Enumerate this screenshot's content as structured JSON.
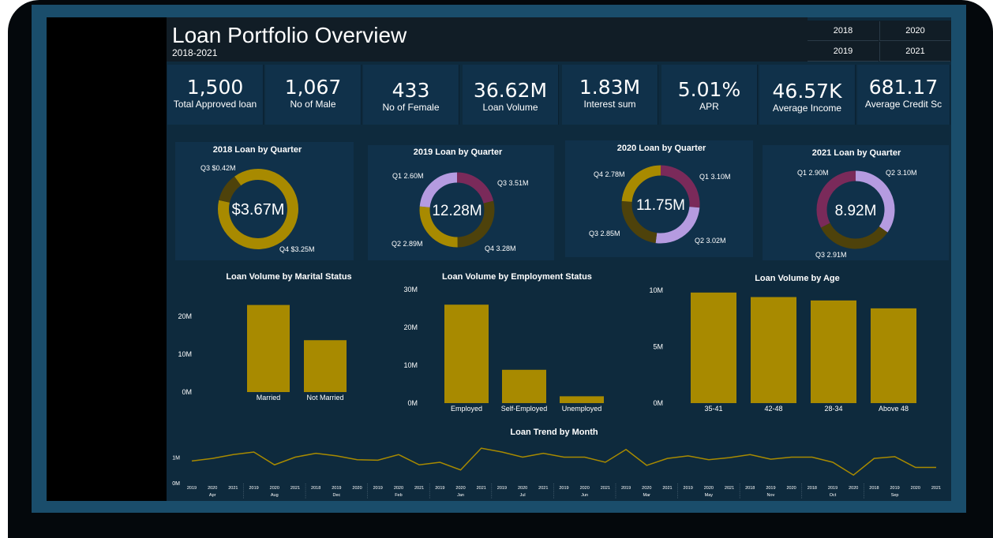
{
  "header": {
    "title": "Loan Portfolio Overview",
    "subtitle": "2018-2021"
  },
  "slicer": {
    "items": [
      "2018",
      "2020",
      "2019",
      "2021"
    ]
  },
  "kpis": [
    {
      "value": "1,500",
      "label": "Total Approved loan"
    },
    {
      "value": "1,067",
      "label": "No of Male"
    },
    {
      "value": "433",
      "label": "No of Female"
    },
    {
      "value": "36.62M",
      "label": "Loan Volume"
    },
    {
      "value": "1.83M",
      "label": "Interest sum"
    },
    {
      "value": "5.01%",
      "label": "APR"
    },
    {
      "value": "46.57K",
      "label": "Average Income"
    },
    {
      "value": "681.17",
      "label": "Average Credit Sc"
    }
  ],
  "colors": {
    "gold": "#a88a00",
    "dark_olive": "#4e420b",
    "purple": "#7a2a5a",
    "lavender": "#b59be0",
    "canvas": "#0e2a3d",
    "panel": "#10314a"
  },
  "donuts": [
    {
      "title": "2018 Loan by Quarter",
      "center": "$3.67M",
      "labels": [
        "Q3 $0.42M",
        "Q4 $3.25M"
      ]
    },
    {
      "title": "2019 Loan by Quarter",
      "center": "12.28M",
      "labels": [
        "Q1 2.60M",
        "Q3 3.51M",
        "Q2 2.89M",
        "Q4 3.28M"
      ]
    },
    {
      "title": "2020 Loan by Quarter",
      "center": "11.75M",
      "labels": [
        "Q4 2.78M",
        "Q1 3.10M",
        "Q3 2.85M",
        "Q2 3.02M"
      ]
    },
    {
      "title": "2021 Loan by Quarter",
      "center": "8.92M",
      "labels": [
        "Q1 2.90M",
        "Q2 3.10M",
        "Q3 2.91M"
      ]
    }
  ],
  "chart_data": [
    {
      "type": "pie",
      "title": "2018 Loan by Quarter",
      "categories": [
        "Q3",
        "Q4"
      ],
      "values": [
        0.42,
        3.25
      ],
      "colors": [
        "#4e420b",
        "#a88a00"
      ]
    },
    {
      "type": "pie",
      "title": "2019 Loan by Quarter",
      "categories": [
        "Q1",
        "Q2",
        "Q3",
        "Q4"
      ],
      "values": [
        2.6,
        2.89,
        3.51,
        3.28
      ],
      "colors": [
        "#7a2a5a",
        "#b59be0",
        "#4e420b",
        "#a88a00"
      ]
    },
    {
      "type": "pie",
      "title": "2020 Loan by Quarter",
      "categories": [
        "Q1",
        "Q2",
        "Q3",
        "Q4"
      ],
      "values": [
        3.1,
        3.02,
        2.85,
        2.78
      ],
      "colors": [
        "#7a2a5a",
        "#b59be0",
        "#4e420b",
        "#a88a00"
      ]
    },
    {
      "type": "pie",
      "title": "2021 Loan by Quarter",
      "categories": [
        "Q1",
        "Q2",
        "Q3"
      ],
      "values": [
        2.9,
        3.1,
        2.91
      ],
      "colors": [
        "#7a2a5a",
        "#b59be0",
        "#4e420b"
      ]
    },
    {
      "type": "bar",
      "title": "Loan Volume by Marital Status",
      "categories": [
        "Married",
        "Not Married"
      ],
      "values": [
        23,
        13.7
      ],
      "ylim": [
        0,
        25
      ],
      "ticks": [
        "0M",
        "10M",
        "20M"
      ]
    },
    {
      "type": "bar",
      "title": "Loan Volume by Employment Status",
      "categories": [
        "Employed",
        "Self-Employed",
        "Unemployed"
      ],
      "values": [
        26,
        8.8,
        1.8
      ],
      "ylim": [
        0,
        30
      ],
      "ticks": [
        "0M",
        "10M",
        "20M",
        "30M"
      ]
    },
    {
      "type": "bar",
      "title": "Loan Volume by Age",
      "categories": [
        "35-41",
        "42-48",
        "28-34",
        "Above 48"
      ],
      "values": [
        9.8,
        9.4,
        9.1,
        8.4
      ],
      "ylim": [
        0,
        10
      ],
      "ticks": [
        "0M",
        "5M",
        "10M"
      ]
    },
    {
      "type": "line",
      "title": "Loan Trend by Month",
      "ticks": [
        "0M",
        "1M"
      ],
      "ylim": [
        0,
        1.6
      ],
      "years": [
        "2019",
        "2020",
        "2021",
        "2019",
        "2020",
        "2021",
        "2018",
        "2019",
        "2020",
        "2019",
        "2020",
        "2021",
        "2019",
        "2020",
        "2021",
        "2019",
        "2020",
        "2021",
        "2019",
        "2020",
        "2021",
        "2019",
        "2020",
        "2021",
        "2019",
        "2020",
        "2021",
        "2018",
        "2019",
        "2020",
        "2018",
        "2019",
        "2020",
        "2018",
        "2019",
        "2020",
        "2021"
      ],
      "months": [
        "Apr",
        "Aug",
        "Dec",
        "Feb",
        "Jan",
        "Jul",
        "Jun",
        "Mar",
        "May",
        "Nov",
        "Oct",
        "Sep"
      ],
      "values": [
        0.85,
        0.95,
        1.1,
        1.2,
        0.7,
        1.0,
        1.15,
        1.05,
        0.9,
        0.88,
        1.1,
        0.7,
        0.8,
        0.5,
        1.35,
        1.2,
        1.0,
        1.15,
        1.0,
        1.0,
        0.8,
        1.3,
        0.68,
        0.95,
        1.05,
        0.9,
        0.98,
        1.1,
        0.92,
        1.0,
        1.0,
        0.8,
        0.3,
        0.95,
        1.02,
        0.6,
        0.6
      ]
    }
  ]
}
